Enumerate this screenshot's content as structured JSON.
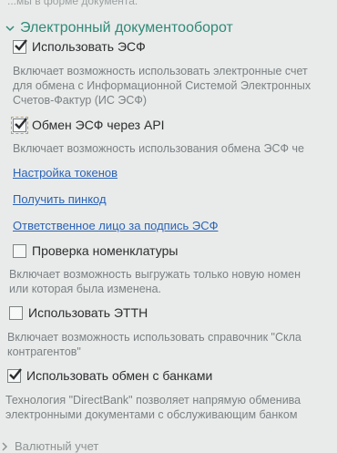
{
  "top_partial": "...мы в форме документа.",
  "section": {
    "title": "Электронный документооборот"
  },
  "items": [
    {
      "label": "Использовать ЭСФ",
      "checked": true,
      "desc": [
        "Включает возможность использовать электронные счет",
        "для обмена с Информационной Системой Электронных",
        "Счетов-Фактур (ИС ЭСФ)"
      ]
    },
    {
      "label": "Обмен ЭСФ через API",
      "checked": true,
      "desc": [
        "Включает возможность использования обмена ЭСФ че"
      ]
    },
    {
      "label": "Проверка номенклатуры",
      "checked": false,
      "desc": [
        "Включает возможность выгружать только новую номен",
        "или которая была изменена."
      ]
    },
    {
      "label": "Использовать ЭТТН",
      "checked": false,
      "desc": [
        "Включает возможность использовать справочник \"Скла",
        "контрагентов\""
      ]
    },
    {
      "label": "Использовать обмен с банками",
      "checked": true,
      "desc": [
        "Технология \"DirectBank\" позволяет напрямую обменива",
        "электронными документами с обслуживающим банком"
      ]
    }
  ],
  "links": {
    "tokens": "Настройка токенов",
    "pincode": "Получить пинкод",
    "responsible": "Ответственное лицо за подпись ЭСФ"
  },
  "bottom_partial": "Валютный учет",
  "colors": {
    "accent": "#2f8a79",
    "link": "#2a63b7",
    "text": "#2d2f31",
    "muted": "#7b8184"
  }
}
